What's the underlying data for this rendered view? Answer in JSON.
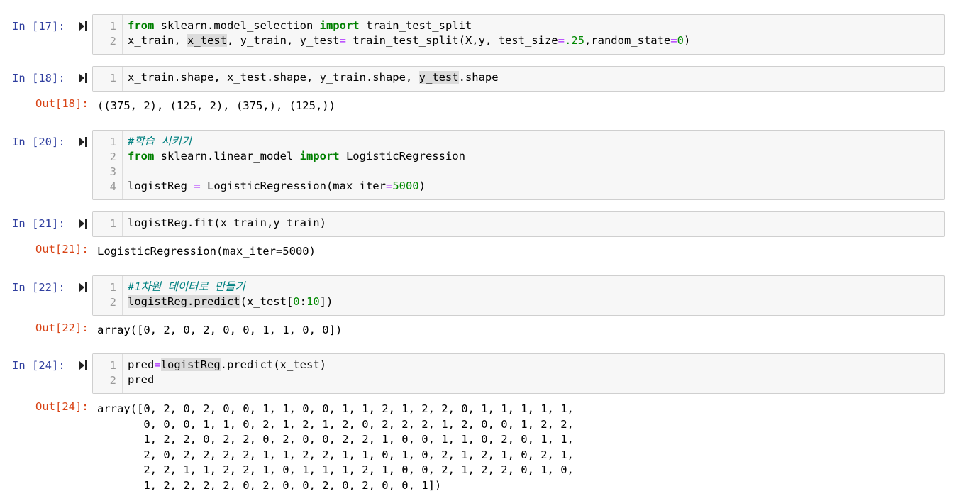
{
  "cells": [
    {
      "id": "17",
      "prompt_in": "In [17]:",
      "lines": [
        [
          {
            "t": "from",
            "c": "kw"
          },
          {
            "t": " sklearn.model_selection ",
            "c": ""
          },
          {
            "t": "import",
            "c": "kw"
          },
          {
            "t": " train_test_split",
            "c": ""
          }
        ],
        [
          {
            "t": "x_train, ",
            "c": ""
          },
          {
            "t": "x_test",
            "c": "hl"
          },
          {
            "t": ", y_train, y_test",
            "c": ""
          },
          {
            "t": "=",
            "c": "op"
          },
          {
            "t": " train_test_split(X,y, test_size",
            "c": ""
          },
          {
            "t": "=",
            "c": "op"
          },
          {
            "t": ".25",
            "c": "num"
          },
          {
            "t": ",random_state",
            "c": ""
          },
          {
            "t": "=",
            "c": "op"
          },
          {
            "t": "0",
            "c": "num"
          },
          {
            "t": ")",
            "c": ""
          }
        ]
      ],
      "prompt_out": "",
      "output": []
    },
    {
      "id": "18",
      "prompt_in": "In [18]:",
      "lines": [
        [
          {
            "t": "x_train.shape, x_test.shape, y_train.shape, ",
            "c": ""
          },
          {
            "t": "y_test",
            "c": "hl"
          },
          {
            "t": ".shape",
            "c": ""
          }
        ]
      ],
      "prompt_out": "Out[18]:",
      "output": [
        "((375, 2), (125, 2), (375,), (125,))"
      ]
    },
    {
      "id": "20",
      "prompt_in": "In [20]:",
      "lines": [
        [
          {
            "t": "#학습 시키기",
            "c": "cm"
          }
        ],
        [
          {
            "t": "from",
            "c": "kw"
          },
          {
            "t": " sklearn.linear_model ",
            "c": ""
          },
          {
            "t": "import",
            "c": "kw"
          },
          {
            "t": " LogisticRegression",
            "c": ""
          }
        ],
        [],
        [
          {
            "t": "logistReg ",
            "c": ""
          },
          {
            "t": "=",
            "c": "op"
          },
          {
            "t": " LogisticRegression(max_iter",
            "c": ""
          },
          {
            "t": "=",
            "c": "op"
          },
          {
            "t": "5000",
            "c": "num"
          },
          {
            "t": ")",
            "c": ""
          }
        ]
      ],
      "prompt_out": "",
      "output": []
    },
    {
      "id": "21",
      "prompt_in": "In [21]:",
      "lines": [
        [
          {
            "t": "logistReg.fit(x_train,y_train)",
            "c": ""
          }
        ]
      ],
      "prompt_out": "Out[21]:",
      "output": [
        "LogisticRegression(max_iter=5000)"
      ]
    },
    {
      "id": "22",
      "prompt_in": "In [22]:",
      "lines": [
        [
          {
            "t": "#1차원 데이터로 만들기",
            "c": "cm"
          }
        ],
        [
          {
            "t": "logistReg.predict",
            "c": "hl"
          },
          {
            "t": "(x_test[",
            "c": ""
          },
          {
            "t": "0",
            "c": "num"
          },
          {
            "t": ":",
            "c": ""
          },
          {
            "t": "10",
            "c": "num"
          },
          {
            "t": "])",
            "c": ""
          }
        ]
      ],
      "prompt_out": "Out[22]:",
      "output": [
        "array([0, 2, 0, 2, 0, 0, 1, 1, 0, 0])"
      ]
    },
    {
      "id": "24",
      "prompt_in": "In [24]:",
      "lines": [
        [
          {
            "t": "pred",
            "c": ""
          },
          {
            "t": "=",
            "c": "op"
          },
          {
            "t": "logistReg",
            "c": "hl"
          },
          {
            "t": ".predict(x_test)",
            "c": ""
          }
        ],
        [
          {
            "t": "pred",
            "c": ""
          }
        ]
      ],
      "prompt_out": "Out[24]:",
      "output": [
        "array([0, 2, 0, 2, 0, 0, 1, 1, 0, 0, 1, 1, 2, 1, 2, 2, 0, 1, 1, 1, 1, 1,",
        "       0, 0, 0, 1, 1, 0, 2, 1, 2, 1, 2, 0, 2, 2, 2, 1, 2, 0, 0, 1, 2, 2,",
        "       1, 2, 2, 0, 2, 2, 0, 2, 0, 0, 2, 2, 1, 0, 0, 1, 1, 0, 2, 0, 1, 1,",
        "       2, 0, 2, 2, 2, 2, 1, 1, 2, 2, 1, 1, 0, 1, 0, 2, 1, 2, 1, 0, 2, 1,",
        "       2, 2, 1, 1, 2, 2, 1, 0, 1, 1, 1, 2, 1, 0, 0, 2, 1, 2, 2, 0, 1, 0,",
        "       1, 2, 2, 2, 2, 0, 2, 0, 0, 2, 0, 2, 0, 0, 1])"
      ]
    }
  ]
}
